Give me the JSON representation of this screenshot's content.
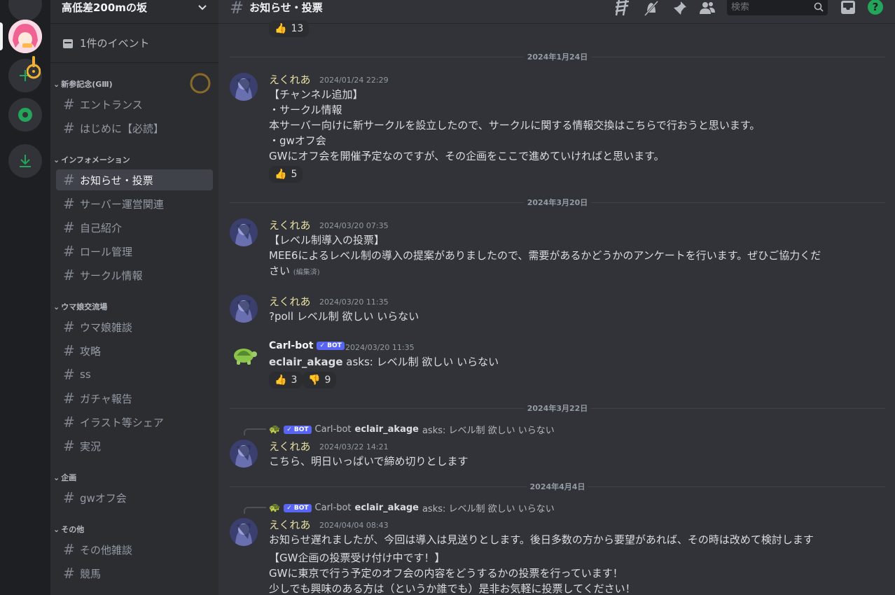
{
  "guild": {
    "name": "高低差200mの坂",
    "events_label": "1件のイベント"
  },
  "sidebar": {
    "categories": [
      {
        "label": "新参記念(GⅢ)"
      },
      {
        "label": "インフォメーション"
      },
      {
        "label": "ウマ娘交流場"
      },
      {
        "label": "企画"
      },
      {
        "label": "その他"
      }
    ],
    "channels": [
      {
        "label": "エントランス"
      },
      {
        "label": "はじめに【必読】"
      },
      {
        "label": "お知らせ・投票"
      },
      {
        "label": "サーバー運営関連"
      },
      {
        "label": "自己紹介"
      },
      {
        "label": "ロール管理"
      },
      {
        "label": "サークル情報"
      },
      {
        "label": "ウマ娘雑談"
      },
      {
        "label": "攻略"
      },
      {
        "label": "ss"
      },
      {
        "label": "ガチャ報告"
      },
      {
        "label": "イラスト等シェア"
      },
      {
        "label": "実況"
      },
      {
        "label": "gwオフ会"
      },
      {
        "label": "その他雑談"
      },
      {
        "label": "競馬"
      }
    ]
  },
  "header": {
    "channel": "お知らせ・投票",
    "search_placeholder": "検索"
  },
  "messages": {
    "top_reaction": {
      "emoji": "👍",
      "count": "13"
    },
    "dividers": [
      "2024年1月24日",
      "2024年3月20日",
      "2024年3月22日",
      "2024年4月4日"
    ],
    "m1": {
      "author": "えくれあ",
      "time": "2024/01/24 22:29",
      "lines": [
        "【チャンネル追加】",
        "・サークル情報",
        "本サーバー向けに新サークルを設立したので、サークルに関する情報交換はこちらで行おうと思います。",
        "・gwオフ会",
        "GWにオフ会を開催予定なのですが、その企画をここで進めていければと思います。"
      ],
      "reaction": {
        "emoji": "👍",
        "count": "5"
      }
    },
    "m2": {
      "author": "えくれあ",
      "time": "2024/03/20 07:35",
      "lines": [
        "【レベル制導入の投票】",
        "MEE6によるレベル制の導入の提案がありましたので、需要があるかどうかのアンケートを行います。ぜひご協力くだ",
        "さい"
      ],
      "edited": "(編集済)"
    },
    "m3": {
      "author": "えくれあ",
      "time": "2024/03/20 11:35",
      "text": "?poll レベル制 欲しい いらない"
    },
    "m4": {
      "author": "Carl-bot",
      "badge": "BOT",
      "time": "2024/03/20 11:35",
      "asker": "eclair_akage",
      "text": "asks: レベル制 欲しい いらない",
      "reactions": [
        {
          "emoji": "👍",
          "count": "3"
        },
        {
          "emoji": "👎",
          "count": "9"
        }
      ]
    },
    "m5": {
      "reply_author": "Carl-bot",
      "reply_badge": "BOT",
      "reply_user": "eclair_akage",
      "reply_text": "asks: レベル制 欲しい いらない",
      "author": "えくれあ",
      "time": "2024/03/22 14:21",
      "text": "こちら、明日いっぱいで締め切りとします"
    },
    "m6": {
      "reply_author": "Carl-bot",
      "reply_badge": "BOT",
      "reply_user": "eclair_akage",
      "reply_text": "asks: レベル制 欲しい いらない",
      "author": "えくれあ",
      "time": "2024/04/04 08:43",
      "lines": [
        "お知らせ遅れましたが、今回は導入は見送りとします。後日多数の方から要望があれば、その時は改めて検討します",
        "【GW企画の投票受け付け中です！】",
        "GWに東京で行う予定のオフ会の内容をどうするかの投票を行っています！",
        "少しでも興味のある方は（というか誰でも）是非お気軽に投票してください！"
      ]
    }
  },
  "colors": {
    "accent": "#5865f2",
    "green": "#23a55a",
    "author": "#e8e0a0"
  }
}
